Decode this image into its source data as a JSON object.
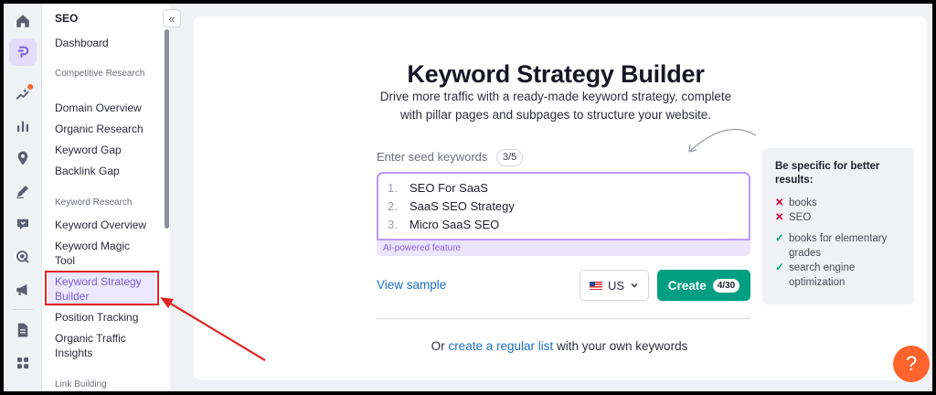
{
  "colors": {
    "accent_purple": "#8a63e8",
    "primary_green": "#009f81",
    "link_blue": "#1a6fc4",
    "help_orange": "#ff642d",
    "annotation_red": "#e02424"
  },
  "rail": {
    "icons": [
      "home-icon",
      "seo-toolkit-icon",
      "ai-trends-icon",
      "reports-chart-icon",
      "local-pin-icon",
      "content-pen-icon",
      "ai-icon",
      "advertising-icon",
      "social-megaphone-icon",
      "document-icon",
      "apps-grid-icon"
    ]
  },
  "nav": {
    "title": "SEO",
    "dashboard": "Dashboard",
    "sections": {
      "competitive": "Competitive Research",
      "keyword": "Keyword Research",
      "link": "Link Building"
    },
    "competitive_items": [
      "Domain Overview",
      "Organic Research",
      "Keyword Gap",
      "Backlink Gap"
    ],
    "keyword_items": [
      "Keyword Overview",
      "Keyword Magic Tool",
      "Keyword Strategy Builder",
      "Position Tracking",
      "Organic Traffic Insights"
    ],
    "collapse_icon": "«"
  },
  "main": {
    "title": "Keyword Strategy Builder",
    "subtitle": "Drive more traffic with a ready-made keyword strategy, complete with pillar pages and subpages to structure your website.",
    "seed_label": "Enter seed keywords",
    "seed_count": "3/5",
    "seeds": [
      {
        "num": "1.",
        "text": "SEO For SaaS"
      },
      {
        "num": "2.",
        "text": "SaaS SEO Strategy"
      },
      {
        "num": "3.",
        "text": "Micro SaaS SEO"
      }
    ],
    "ai_label": "AI-powered feature",
    "view_sample": "View sample",
    "country": "US",
    "create_label": "Create",
    "create_count": "4/30",
    "or_prefix": "Or",
    "or_link": "create a regular list",
    "or_suffix": "with your own keywords"
  },
  "tips": {
    "title": "Be specific for better results:",
    "bad": [
      "books",
      "SEO"
    ],
    "good": [
      "books for elementary grades",
      "search engine optimization"
    ],
    "bad_mark": "✕",
    "good_mark": "✓"
  },
  "help": {
    "label": "?"
  }
}
